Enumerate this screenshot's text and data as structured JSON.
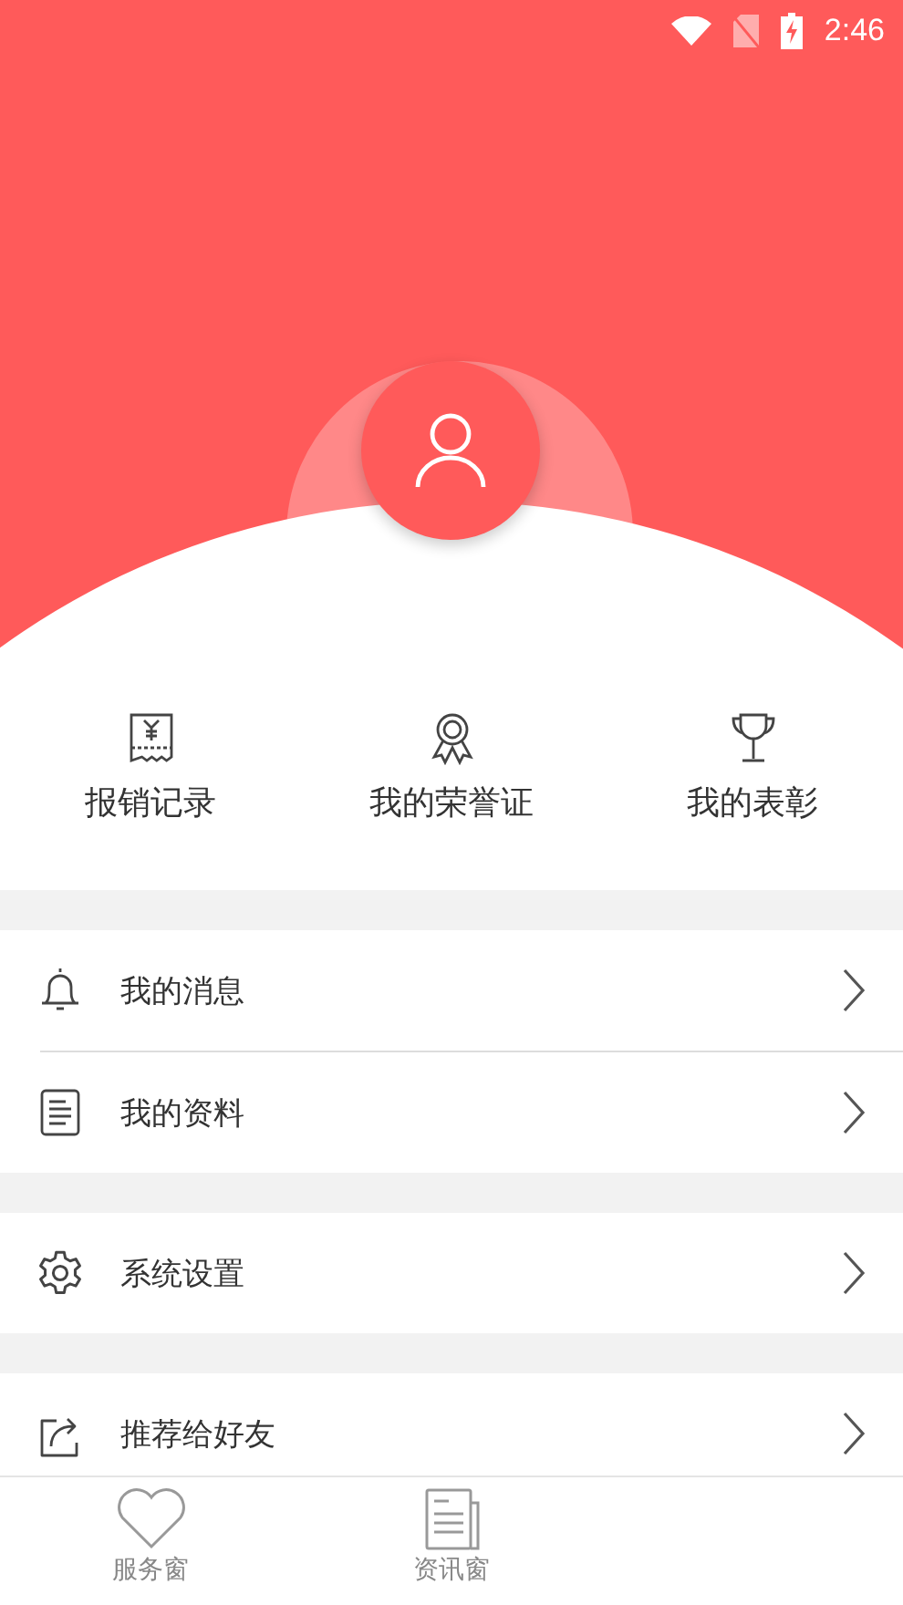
{
  "status_bar": {
    "time": "2:46"
  },
  "shortcuts": [
    {
      "label": "报销记录"
    },
    {
      "label": "我的荣誉证"
    },
    {
      "label": "我的表彰"
    }
  ],
  "menu_groups": [
    [
      {
        "label": "我的消息"
      },
      {
        "label": "我的资料"
      }
    ],
    [
      {
        "label": "系统设置"
      }
    ],
    [
      {
        "label": "推荐给好友"
      }
    ]
  ],
  "tab_bar": [
    {
      "label": "服务窗"
    },
    {
      "label": "资讯窗"
    }
  ]
}
